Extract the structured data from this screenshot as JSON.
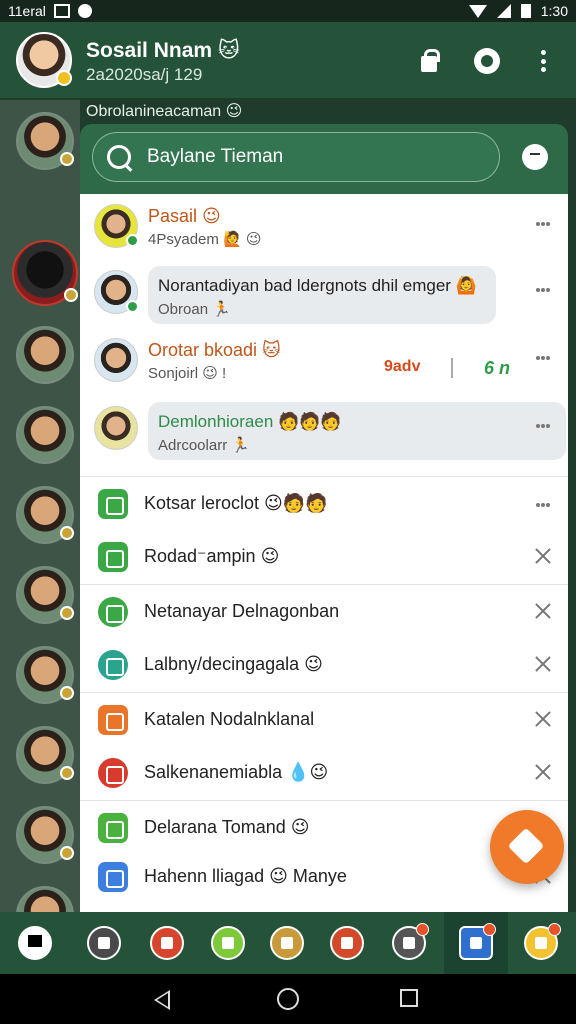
{
  "status_bar": {
    "left_text": "11eral",
    "time": "1:30"
  },
  "header": {
    "title": "Sosail Nnam 🐱",
    "subtitle": "2a2020sa/j 129"
  },
  "section_label": "Obrolanineacaman 😉",
  "search": {
    "placeholder": "Baylane Tieman"
  },
  "chats": [
    {
      "name": "Pasail 😉",
      "message": "4Psyadem 🙋 😉",
      "name_color": "#c0571a"
    },
    {
      "name": "Norantadiyan bad ldergnots dhil emger 🙆",
      "message": "Obroan 🏃"
    },
    {
      "name": "Orotar bkoadi 🐱",
      "message": "Sonjoirl 😉 !",
      "tag_a": "9adv",
      "tag_b": "6 n",
      "name_color": "#c0571a"
    },
    {
      "name": "Demlonhioraen 🧑🧑🧑",
      "message": "Adrcoolarr 🏃",
      "name_color": "#2e8b4a"
    }
  ],
  "apps": [
    {
      "label": "Kotsar leroclot 😉🧑🧑",
      "color": "#3aa845",
      "action": "more"
    },
    {
      "label": "Rodad⁻ampin 😉",
      "color": "#3aa845",
      "action": "close"
    },
    {
      "label": "Netanayar Delnagonban",
      "color": "#3aa845",
      "action": "close"
    },
    {
      "label": "Lalbny/decingagala 😉",
      "color": "#2aa38f",
      "action": "close"
    },
    {
      "label": "Katalen Nodalnklanal",
      "color": "#e8752a",
      "action": "close"
    },
    {
      "label": "Salkenanemiabla 💧😉",
      "color": "#d83a2e",
      "action": "close"
    },
    {
      "label": "Delarana Tomand 😉",
      "color": "#4cb23f",
      "action": "close"
    },
    {
      "label": "Hahenn lliagad 😉 Manye",
      "color": "#3d7fe0",
      "action": "close"
    }
  ],
  "dock": [
    {
      "icon": "home-icon",
      "color": "#000000"
    },
    {
      "icon": "shopping-icon",
      "color": "#4a4a4a"
    },
    {
      "icon": "calendar-icon",
      "color": "#d8452e"
    },
    {
      "icon": "phone-icon",
      "color": "#7dc93a"
    },
    {
      "icon": "notes-icon",
      "color": "#c99a3a"
    },
    {
      "icon": "books-icon",
      "color": "#d24a2a"
    },
    {
      "icon": "compass-icon",
      "color": "#555555"
    },
    {
      "icon": "mail-icon",
      "color": "#2f6fd0"
    },
    {
      "icon": "emoji-icon",
      "color": "#f2c230"
    }
  ]
}
